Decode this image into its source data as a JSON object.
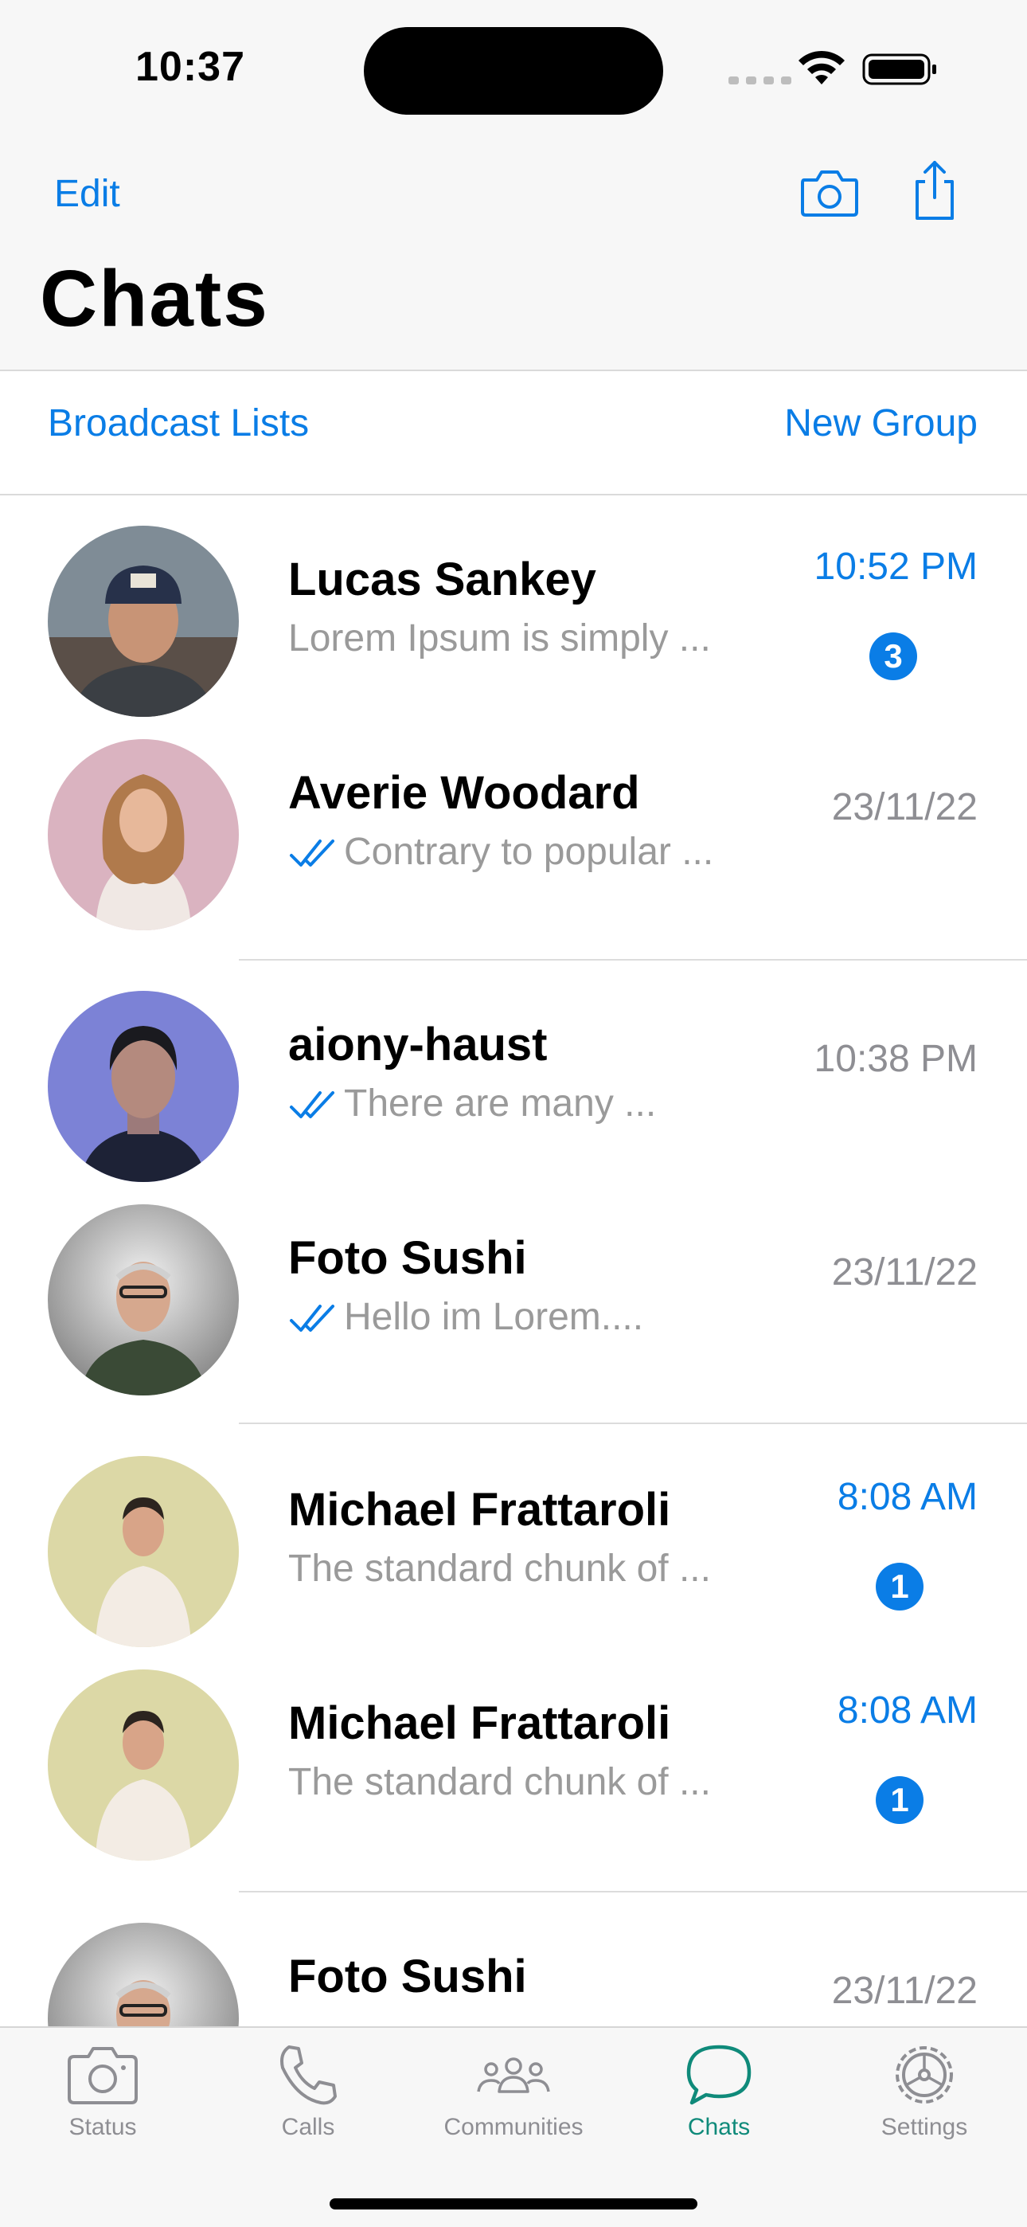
{
  "status_bar": {
    "time": "10:37"
  },
  "header": {
    "edit_label": "Edit",
    "title": "Chats",
    "camera_icon": "camera-icon",
    "share_icon": "share-icon"
  },
  "actions": {
    "broadcast_label": "Broadcast Lists",
    "new_group_label": "New Group"
  },
  "chats": [
    {
      "name": "Lucas Sankey",
      "preview": "Lorem Ipsum is simply ...",
      "time": "10:52 PM",
      "unread": "3",
      "read_ticks": false
    },
    {
      "name": "Averie Woodard",
      "preview": "Contrary to popular ...",
      "time": "23/11/22",
      "unread": "",
      "read_ticks": true
    },
    {
      "name": "aiony-haust",
      "preview": "There are many ...",
      "time": "10:38 PM",
      "unread": "",
      "read_ticks": true
    },
    {
      "name": "Foto Sushi",
      "preview": "Hello im Lorem....",
      "time": "23/11/22",
      "unread": "",
      "read_ticks": true
    },
    {
      "name": "Michael Frattaroli",
      "preview": "The standard chunk of ...",
      "time": "8:08 AM",
      "unread": "1",
      "read_ticks": false
    },
    {
      "name": "Michael Frattaroli",
      "preview": "The standard chunk of ...",
      "time": "8:08 AM",
      "unread": "1",
      "read_ticks": false
    },
    {
      "name": "Foto Sushi",
      "preview": "",
      "time": "23/11/22",
      "unread": "",
      "read_ticks": false
    }
  ],
  "tabs": [
    {
      "label": "Status",
      "icon": "camera-icon",
      "active": false
    },
    {
      "label": "Calls",
      "icon": "phone-icon",
      "active": false
    },
    {
      "label": "Communities",
      "icon": "communities-icon",
      "active": false
    },
    {
      "label": "Chats",
      "icon": "chat-bubble-icon",
      "active": true
    },
    {
      "label": "Settings",
      "icon": "gear-icon",
      "active": false
    }
  ],
  "colors": {
    "accent": "#0a7de6",
    "active_tab": "#0f8a7a",
    "secondary_text": "#8e8e93",
    "header_bg": "#f7f7f7"
  }
}
